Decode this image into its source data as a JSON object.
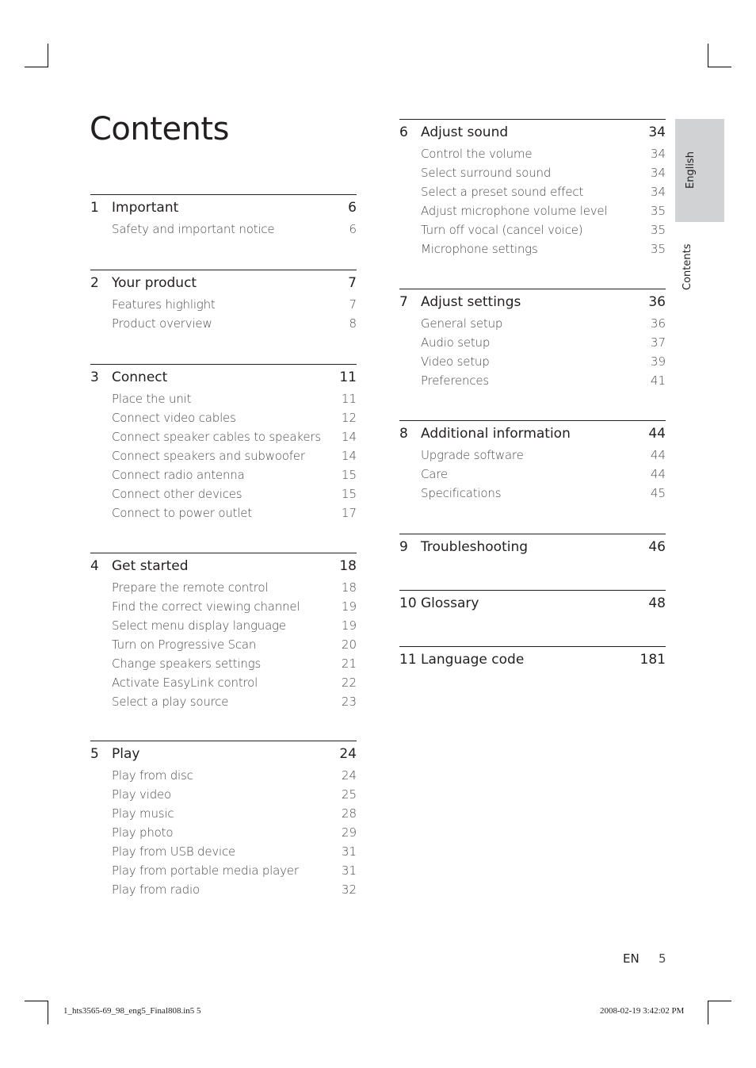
{
  "page": {
    "title": "Contents",
    "side_tabs": {
      "language": "English",
      "section": "Contents"
    },
    "footer": {
      "lang": "EN",
      "page_number": "5"
    },
    "slug": {
      "file": "1_hts3565-69_98_eng5_Final808.in5   5",
      "timestamp": "2008-02-19   3:42:02 PM"
    }
  },
  "toc_left": [
    {
      "num": "1",
      "title": "Important",
      "page": "6",
      "items": [
        {
          "title": "Safety and important notice",
          "page": "6"
        }
      ]
    },
    {
      "num": "2",
      "title": "Your product",
      "page": "7",
      "items": [
        {
          "title": "Features highlight",
          "page": "7"
        },
        {
          "title": "Product overview",
          "page": "8"
        }
      ]
    },
    {
      "num": "3",
      "title": "Connect",
      "page": "11",
      "items": [
        {
          "title": "Place the unit",
          "page": "11"
        },
        {
          "title": "Connect video cables",
          "page": "12"
        },
        {
          "title": "Connect speaker cables to speakers",
          "page": "14"
        },
        {
          "title": "Connect speakers and subwoofer",
          "page": "14"
        },
        {
          "title": "Connect radio antenna",
          "page": "15"
        },
        {
          "title": "Connect other devices",
          "page": "15"
        },
        {
          "title": "Connect to power outlet",
          "page": "17"
        }
      ]
    },
    {
      "num": "4",
      "title": "Get started",
      "page": "18",
      "items": [
        {
          "title": "Prepare the remote control",
          "page": "18"
        },
        {
          "title": "Find the correct viewing channel",
          "page": "19"
        },
        {
          "title": "Select menu display language",
          "page": "19"
        },
        {
          "title": "Turn on Progressive Scan",
          "page": "20"
        },
        {
          "title": "Change speakers settings",
          "page": "21"
        },
        {
          "title": "Activate EasyLink control",
          "page": "22"
        },
        {
          "title": "Select a play source",
          "page": "23"
        }
      ]
    },
    {
      "num": "5",
      "title": "Play",
      "page": "24",
      "items": [
        {
          "title": "Play from disc",
          "page": "24"
        },
        {
          "title": "Play video",
          "page": "25"
        },
        {
          "title": "Play music",
          "page": "28"
        },
        {
          "title": "Play photo",
          "page": "29"
        },
        {
          "title": "Play from USB device",
          "page": "31"
        },
        {
          "title": "Play from portable media player",
          "page": "31"
        },
        {
          "title": "Play from radio",
          "page": "32"
        }
      ]
    }
  ],
  "toc_right": [
    {
      "num": "6",
      "title": "Adjust sound",
      "page": "34",
      "items": [
        {
          "title": "Control the volume",
          "page": "34"
        },
        {
          "title": "Select surround sound",
          "page": "34"
        },
        {
          "title": "Select a preset sound effect",
          "page": "34"
        },
        {
          "title": "Adjust microphone volume level",
          "page": "35"
        },
        {
          "title": "Turn off vocal (cancel voice)",
          "page": "35"
        },
        {
          "title": "Microphone settings",
          "page": "35"
        }
      ]
    },
    {
      "num": "7",
      "title": "Adjust settings",
      "page": "36",
      "items": [
        {
          "title": "General setup",
          "page": "36"
        },
        {
          "title": "Audio setup",
          "page": "37"
        },
        {
          "title": "Video setup",
          "page": "39"
        },
        {
          "title": "Preferences",
          "page": "41"
        }
      ]
    },
    {
      "num": "8",
      "title": "Additional information",
      "page": "44",
      "items": [
        {
          "title": "Upgrade software",
          "page": "44"
        },
        {
          "title": "Care",
          "page": "44"
        },
        {
          "title": "Specifications",
          "page": "45"
        }
      ]
    },
    {
      "num": "9",
      "title": "Troubleshooting",
      "page": "46",
      "items": []
    },
    {
      "num": "10",
      "title": "Glossary",
      "page": "48",
      "items": []
    },
    {
      "num": "11",
      "title": "Language code",
      "page": "181",
      "items": []
    }
  ]
}
